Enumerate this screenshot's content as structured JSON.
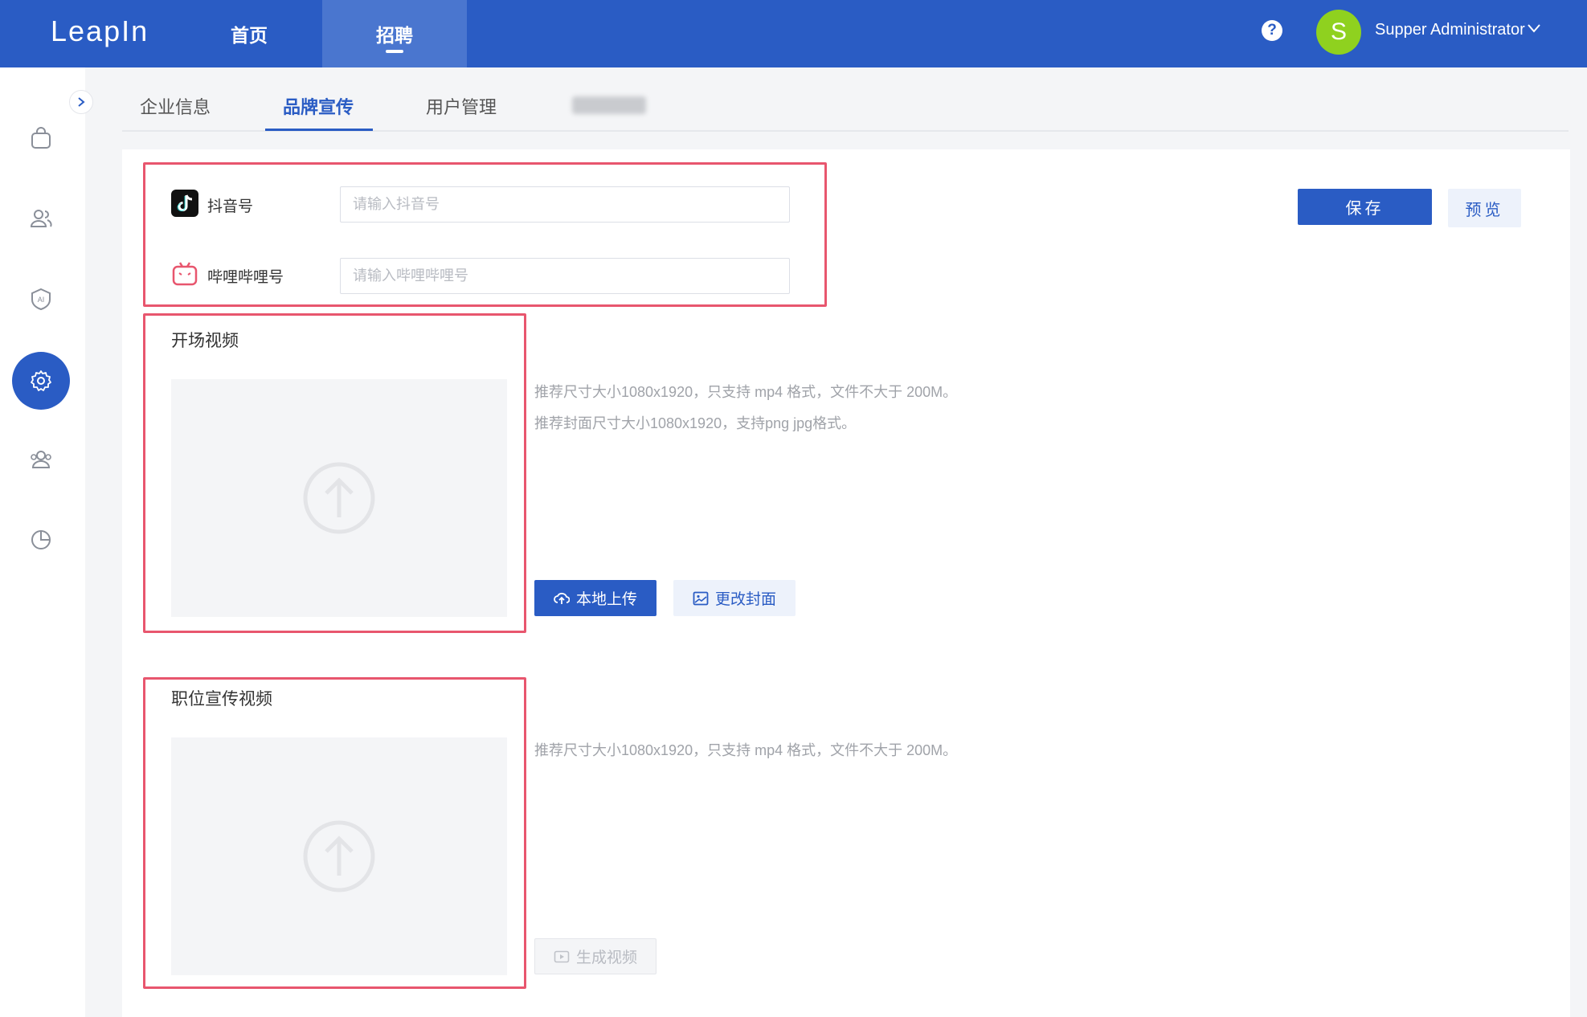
{
  "app": {
    "logo": "LeapIn"
  },
  "topnav": {
    "items": [
      {
        "label": "首页"
      },
      {
        "label": "招聘"
      }
    ],
    "active": "招聘"
  },
  "header": {
    "help_symbol": "?",
    "avatar_initial": "S",
    "user_name": "Supper Administrator"
  },
  "sidebar": {
    "icons": [
      "bag-icon",
      "users-icon",
      "ai-shield-icon",
      "settings-icon",
      "group-icon",
      "pie-chart-icon"
    ],
    "active": "settings-icon"
  },
  "tabs": {
    "items": [
      {
        "label": "企业信息"
      },
      {
        "label": "品牌宣传"
      },
      {
        "label": "用户管理"
      }
    ],
    "active": "品牌宣传"
  },
  "social": {
    "douyin": {
      "label": "抖音号",
      "placeholder": "请输入抖音号",
      "value": ""
    },
    "bilibili": {
      "label": "哔哩哔哩号",
      "placeholder": "请输入哔哩哔哩号",
      "value": ""
    }
  },
  "actions": {
    "save": "保存",
    "preview": "预览"
  },
  "opening_video": {
    "title": "开场视频",
    "hint1": "推荐尺寸大小1080x1920，只支持 mp4 格式，文件不大于 200M。",
    "hint2": "推荐封面尺寸大小1080x1920，支持png jpg格式。",
    "upload_label": "本地上传",
    "cover_label": "更改封面"
  },
  "job_video": {
    "title": "职位宣传视频",
    "hint": "推荐尺寸大小1080x1920，只支持 mp4 格式，文件不大于 200M。",
    "generate_label": "生成视频"
  },
  "colors": {
    "primary": "#2a5cc4",
    "highlight": "#e8566e",
    "avatar": "#8fd11f"
  }
}
